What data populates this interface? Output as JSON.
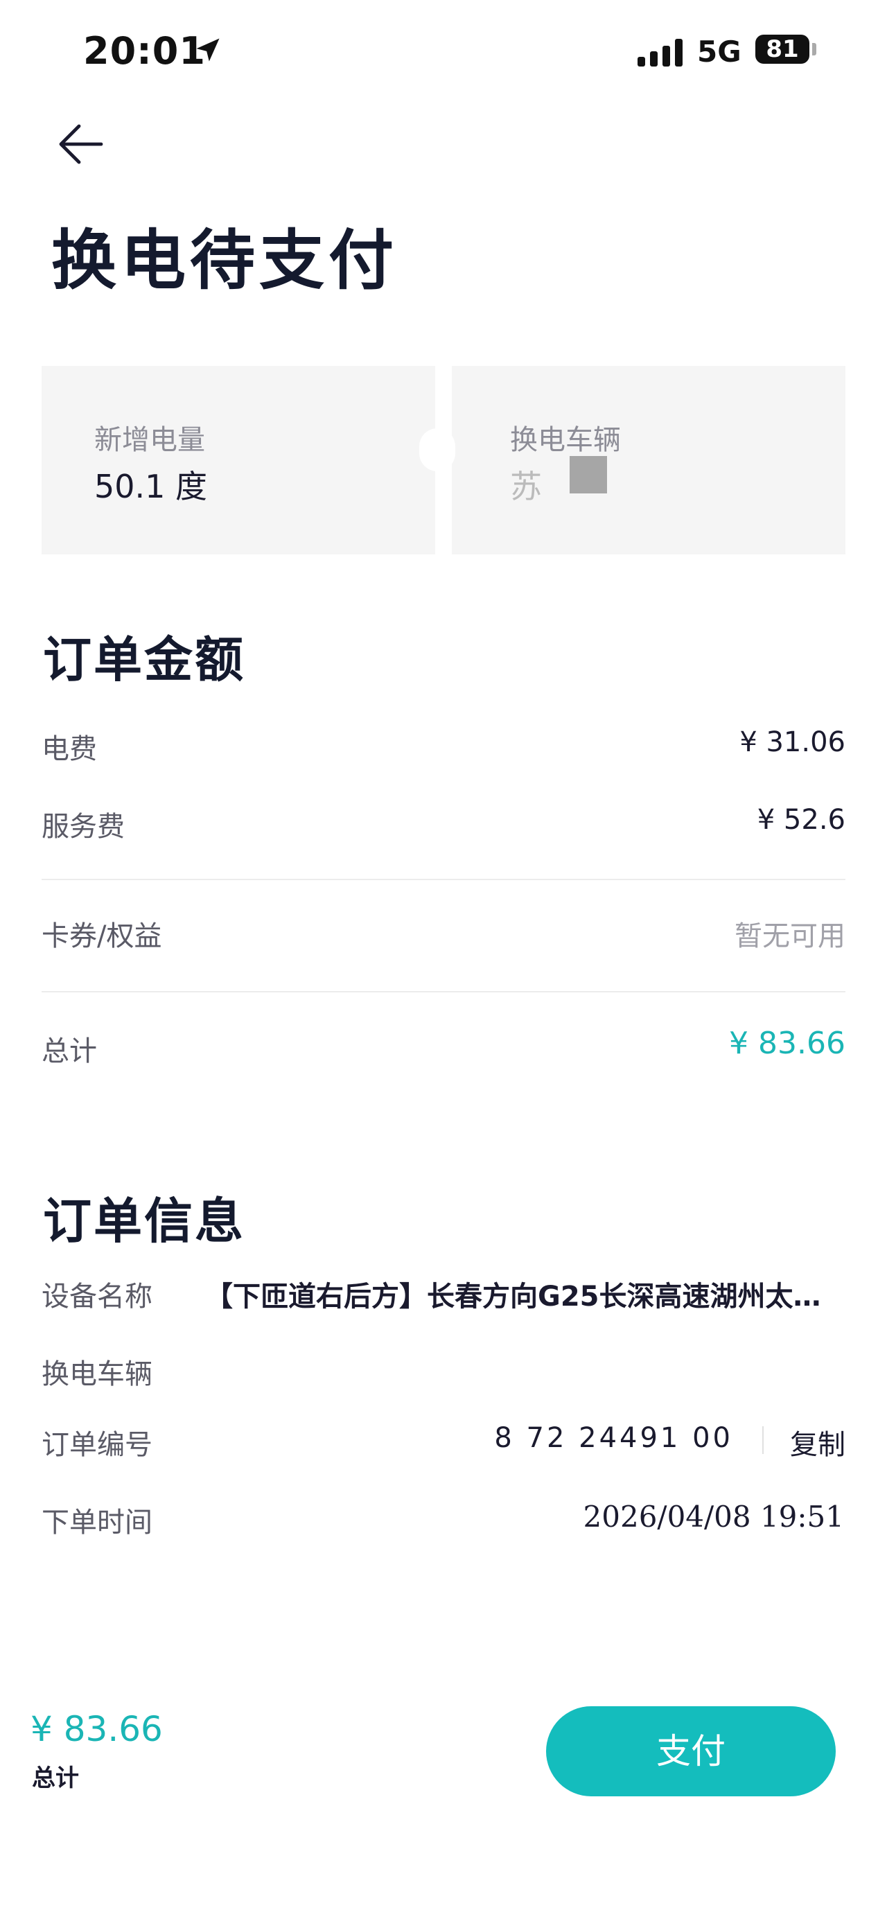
{
  "status_bar": {
    "time": "20:01",
    "network": "5G",
    "battery": "81"
  },
  "header": {
    "title": "换电待支付"
  },
  "cards": [
    {
      "label": "新增电量",
      "value": "50.1 度"
    },
    {
      "label": "换电车辆",
      "value": "苏"
    }
  ],
  "order_amount": {
    "title": "订单金额",
    "rows": [
      {
        "label": "电费",
        "value": "¥ 31.06"
      },
      {
        "label": "服务费",
        "value": "¥ 52.6"
      },
      {
        "label": "卡券/权益",
        "value": "暂无可用"
      },
      {
        "label": "总计",
        "value": "¥ 83.66"
      }
    ]
  },
  "order_info": {
    "title": "订单信息",
    "device_label": "设备名称",
    "device_value": "【下匝道右后方】长春方向G25长深高速湖州太…",
    "vehicle_label": "换电车辆",
    "order_no_label": "订单编号",
    "order_no_value": "8    72  24491    00",
    "copy_label": "复制",
    "time_label": "下单时间",
    "time_value": "2026/04/08 19:51"
  },
  "bottom_bar": {
    "amount": "¥ 83.66",
    "total_label": "总计",
    "pay_label": "支付"
  },
  "colors": {
    "accent": "#14bdbd",
    "card_bg": "#f5f5f5"
  },
  "icons": {
    "back": "arrow-left-icon",
    "location": "location-arrow-icon"
  }
}
